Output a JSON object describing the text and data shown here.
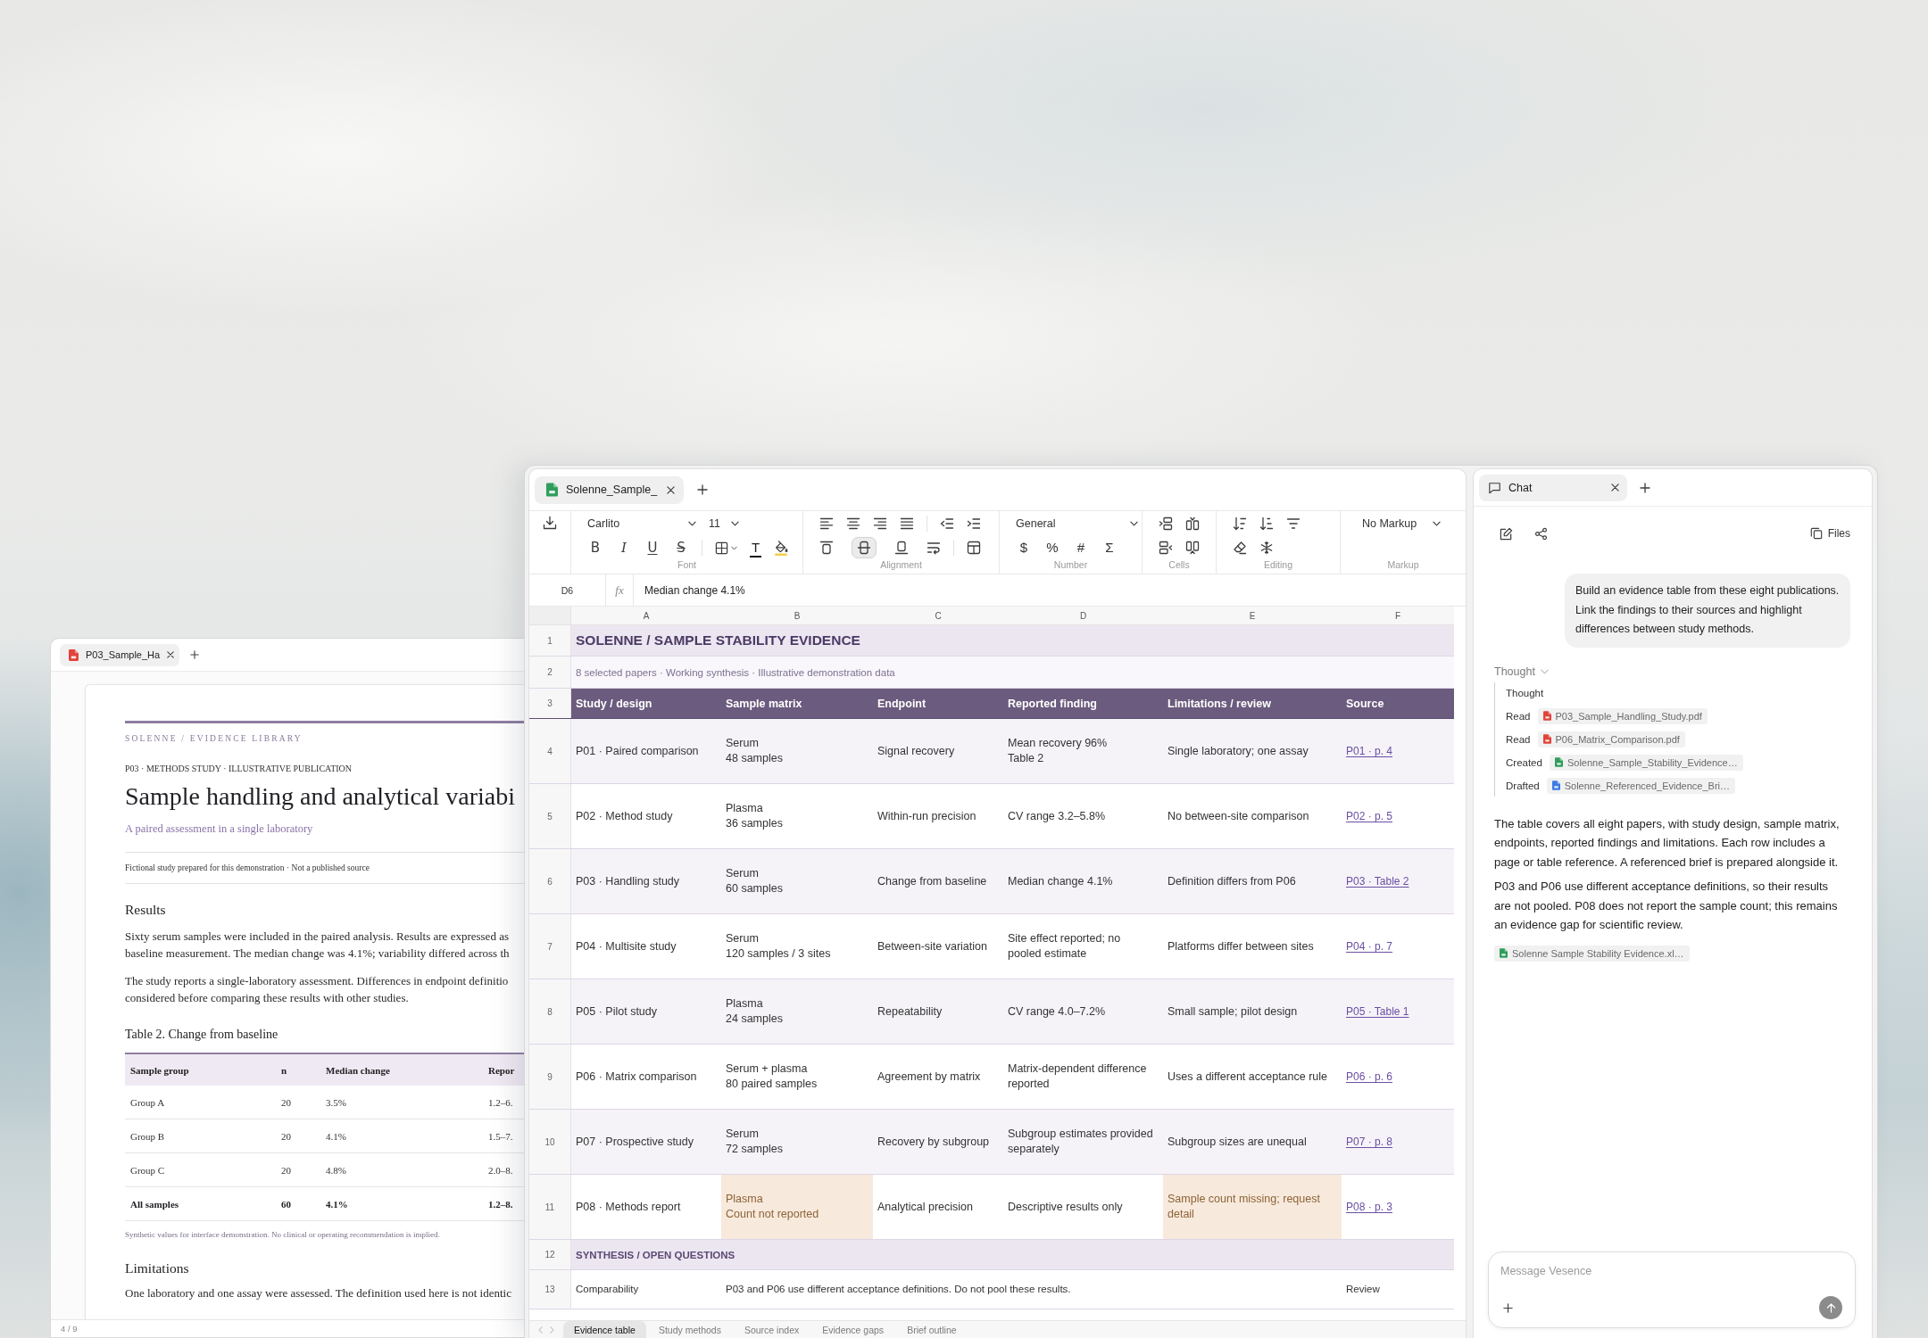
{
  "pdf_viewer": {
    "tab": {
      "title": "P03_Sample_Ha"
    },
    "page": {
      "library": "SOLENNE / EVIDENCE LIBRARY",
      "kicker": "P03 · METHODS STUDY · ILLUSTRATIVE PUBLICATION",
      "title": "Sample handling and analytical variabi",
      "subtitle": "A paired assessment in a single laboratory",
      "notice": "Fictional study prepared for this demonstration · Not a published source",
      "results": {
        "heading": "Results",
        "paragraphs": [
          {
            "lines": [
              "Sixty serum samples were included in the paired analysis. Results are expressed as",
              "baseline measurement. The median change was 4.1%; variability differed across th"
            ]
          },
          {
            "lines": [
              "The study reports a single-laboratory assessment. Differences in endpoint definitio",
              "considered before comparing these results with other studies."
            ]
          }
        ]
      },
      "table": {
        "caption": "Table 2. Change from baseline",
        "columns": [
          "Sample group",
          "n",
          "Median change",
          "Repor"
        ],
        "rows": [
          {
            "cells": [
              "Group A",
              "20",
              "3.5%",
              "1.2–6."
            ],
            "total": false
          },
          {
            "cells": [
              "Group B",
              "20",
              "4.1%",
              "1.5–7."
            ],
            "total": false
          },
          {
            "cells": [
              "Group C",
              "20",
              "4.8%",
              "2.0–8."
            ],
            "total": false
          },
          {
            "cells": [
              "All samples",
              "60",
              "4.1%",
              "1.2–8."
            ],
            "total": true
          }
        ],
        "note": "Synthetic values for interface demonstration. No clinical or operating recommendation is implied."
      },
      "limitations": {
        "heading": "Limitations",
        "lines": [
          "One laboratory and one assay were assessed. The definition used here is not identic"
        ]
      }
    },
    "page_indicator": "4 / 9"
  },
  "spreadsheet": {
    "tab": {
      "title": "Solenne_Sample_"
    },
    "toolbar": {
      "font_family": "Carlito",
      "font_size": "11",
      "text_styles": [
        {
          "kind": "bold",
          "glyph": "B"
        },
        {
          "kind": "italic",
          "glyph": "I"
        },
        {
          "kind": "underline",
          "glyph": "U"
        },
        {
          "kind": "strike",
          "glyph": "S"
        }
      ],
      "text_color_glyph": "T",
      "vertical_align": [
        {
          "kind": "top",
          "selected": false
        },
        {
          "kind": "middle",
          "selected": true
        },
        {
          "kind": "bottom",
          "selected": false
        }
      ],
      "number_format": "General",
      "number_buttons": [
        "$",
        "%",
        "#",
        "Σ"
      ],
      "markup": "No Markup",
      "group_labels": [
        "Font",
        "Alignment",
        "Number",
        "Cells",
        "Editing",
        "Markup"
      ]
    },
    "formula_bar": {
      "cell": "D6",
      "function_label": "fx",
      "value": "Median change 4.1%"
    },
    "columns": [
      "A",
      "B",
      "C",
      "D",
      "E",
      "F"
    ],
    "rows": [
      {
        "number": "1",
        "kind": "title",
        "text": "SOLENNE / SAMPLE STABILITY EVIDENCE"
      },
      {
        "number": "2",
        "kind": "subtitle",
        "text": "8 selected papers · Working synthesis · Illustrative demonstration data"
      },
      {
        "number": "3",
        "kind": "header",
        "cells": [
          "Study / design",
          "Sample matrix",
          "Endpoint",
          "Reported finding",
          "Limitations / review",
          "Source"
        ]
      },
      {
        "number": "4",
        "kind": "record",
        "cells": [
          {
            "text": "P01 · Paired comparison",
            "flagged": false
          },
          {
            "text": "Serum\n48 samples",
            "flagged": false
          },
          {
            "text": "Signal recovery",
            "flagged": false
          },
          {
            "text": "Mean recovery 96%\nTable 2",
            "flagged": false
          },
          {
            "text": "Single laboratory; one assay",
            "flagged": false
          }
        ],
        "source": "P01 · p. 4"
      },
      {
        "number": "5",
        "kind": "record",
        "cells": [
          {
            "text": "P02 · Method study",
            "flagged": false
          },
          {
            "text": "Plasma\n36 samples",
            "flagged": false
          },
          {
            "text": "Within-run precision",
            "flagged": false
          },
          {
            "text": "CV range 3.2–5.8%",
            "flagged": false
          },
          {
            "text": "No between-site comparison",
            "flagged": false
          }
        ],
        "source": "P02 · p. 5"
      },
      {
        "number": "6",
        "kind": "record",
        "cells": [
          {
            "text": "P03 · Handling study",
            "flagged": false
          },
          {
            "text": "Serum\n60 samples",
            "flagged": false
          },
          {
            "text": "Change from baseline",
            "flagged": false
          },
          {
            "text": "Median change 4.1%",
            "flagged": false
          },
          {
            "text": "Definition differs from P06",
            "flagged": false
          }
        ],
        "source": "P03 · Table 2"
      },
      {
        "number": "7",
        "kind": "record",
        "cells": [
          {
            "text": "P04 · Multisite study",
            "flagged": false
          },
          {
            "text": "Serum\n120 samples / 3 sites",
            "flagged": false
          },
          {
            "text": "Between-site variation",
            "flagged": false
          },
          {
            "text": "Site effect reported; no\npooled estimate",
            "flagged": false
          },
          {
            "text": "Platforms differ between sites",
            "flagged": false
          }
        ],
        "source": "P04 · p. 7"
      },
      {
        "number": "8",
        "kind": "record",
        "cells": [
          {
            "text": "P05 · Pilot study",
            "flagged": false
          },
          {
            "text": "Plasma\n24 samples",
            "flagged": false
          },
          {
            "text": "Repeatability",
            "flagged": false
          },
          {
            "text": "CV range 4.0–7.2%",
            "flagged": false
          },
          {
            "text": "Small sample; pilot design",
            "flagged": false
          }
        ],
        "source": "P05 · Table 1"
      },
      {
        "number": "9",
        "kind": "record",
        "cells": [
          {
            "text": "P06 · Matrix comparison",
            "flagged": false
          },
          {
            "text": "Serum + plasma\n80 paired samples",
            "flagged": false
          },
          {
            "text": "Agreement by matrix",
            "flagged": false
          },
          {
            "text": "Matrix-dependent difference reported",
            "flagged": false
          },
          {
            "text": "Uses a different acceptance rule",
            "flagged": false
          }
        ],
        "source": "P06 · p. 6"
      },
      {
        "number": "10",
        "kind": "record",
        "cells": [
          {
            "text": "P07 · Prospective study",
            "flagged": false
          },
          {
            "text": "Serum\n72 samples",
            "flagged": false
          },
          {
            "text": "Recovery by subgroup",
            "flagged": false
          },
          {
            "text": "Subgroup estimates provided separately",
            "flagged": false
          },
          {
            "text": "Subgroup sizes are unequal",
            "flagged": false
          }
        ],
        "source": "P07 · p. 8"
      },
      {
        "number": "11",
        "kind": "record",
        "cells": [
          {
            "text": "P08 · Methods report",
            "flagged": false
          },
          {
            "text": "Plasma\nCount not reported",
            "flagged": true
          },
          {
            "text": "Analytical precision",
            "flagged": false
          },
          {
            "text": "Descriptive results only",
            "flagged": false
          },
          {
            "text": "Sample count missing; request detail",
            "flagged": true
          }
        ],
        "source": "P08 · p. 3"
      },
      {
        "number": "12",
        "kind": "section",
        "text": "SYNTHESIS / OPEN QUESTIONS"
      },
      {
        "number": "13",
        "kind": "note",
        "cells": [
          "Comparability",
          "P03 and P06 use different acceptance definitions. Do not pool these results.",
          "Review"
        ]
      }
    ],
    "sheet_tabs": [
      {
        "label": "Evidence table",
        "selected": true
      },
      {
        "label": "Study methods",
        "selected": false
      },
      {
        "label": "Source index",
        "selected": false
      },
      {
        "label": "Evidence gaps",
        "selected": false
      },
      {
        "label": "Brief outline",
        "selected": false
      }
    ]
  },
  "chat": {
    "tab": {
      "title": "Chat"
    },
    "files_label": "Files",
    "user_message": "Build an evidence table from these eight publications. Link the findings to their sources and highlight differences between study methods.",
    "thought": {
      "label": "Thought",
      "expanded": true,
      "steps": [
        {
          "kind": "note",
          "label": "Thought"
        },
        {
          "kind": "file",
          "label": "Read",
          "file": {
            "name": "P03_Sample_Handling_Study.pdf",
            "kind": "pdf"
          }
        },
        {
          "kind": "file",
          "label": "Read",
          "file": {
            "name": "P06_Matrix_Comparison.pdf",
            "kind": "pdf"
          }
        },
        {
          "kind": "file",
          "label": "Created",
          "file": {
            "name": "Solenne_Sample_Stability_Evidence…",
            "kind": "sheet"
          }
        },
        {
          "kind": "file",
          "label": "Drafted",
          "file": {
            "name": "Solenne_Referenced_Evidence_Bri…",
            "kind": "doc"
          }
        }
      ]
    },
    "reply": [
      "The table covers all eight papers, with study design, sample matrix, endpoints, reported findings and limitations. Each row includes a page or table reference. A referenced brief is prepared alongside it.",
      "P03 and P06 use different acceptance definitions, so their results are not pooled. P08 does not report the sample count; this remains an evidence gap for scientific review."
    ],
    "attachment": {
      "name": "Solenne Sample Stability Evidence.xl…",
      "kind": "sheet"
    },
    "composer": {
      "placeholder": "Message Vesence"
    }
  }
}
